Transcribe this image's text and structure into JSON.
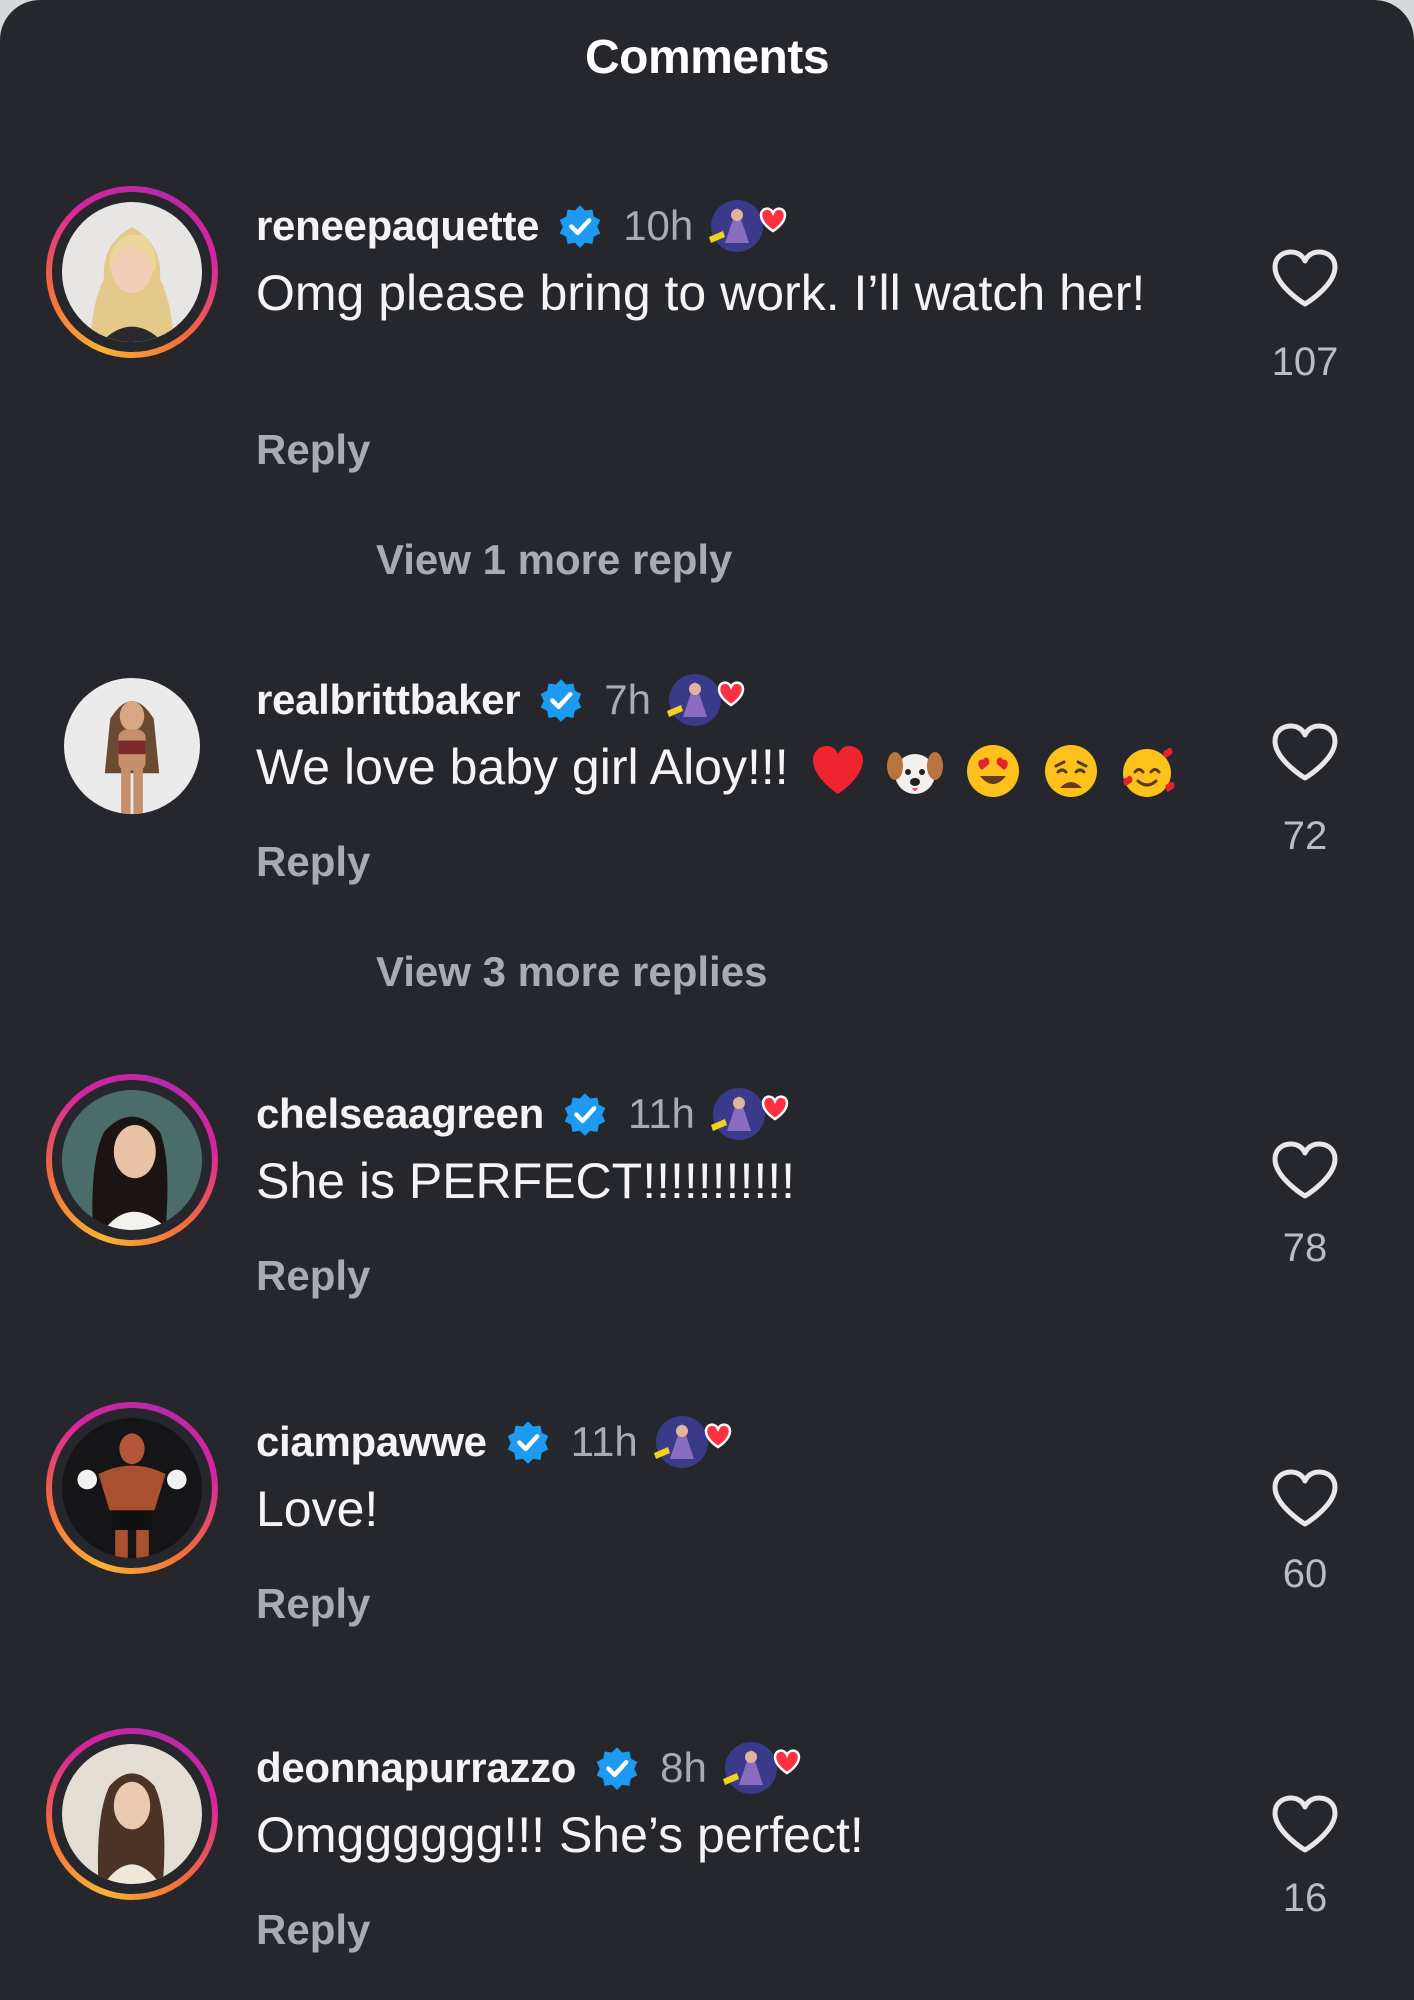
{
  "header": {
    "title": "Comments"
  },
  "colors": {
    "background": "#25272c",
    "primary_text": "#f4f4f5",
    "secondary_text": "#a8abb1",
    "verified_blue": "#1d9bf0",
    "heart_red": "#ff3040",
    "story_ring": [
      "#f9b233",
      "#f26a3d",
      "#d6249f"
    ]
  },
  "comments": [
    {
      "username": "reneepaquette",
      "verified": true,
      "time": "10h",
      "text": "Omg please bring to work. I’ll watch her!",
      "reply_label": "Reply",
      "likes": "107",
      "has_story_ring": true,
      "view_more": "View 1 more reply"
    },
    {
      "username": "realbrittbaker",
      "verified": true,
      "time": "7h",
      "text": "We love baby girl Aloy!!!",
      "emojis": [
        "red-heart",
        "dog-face",
        "heart-eyes",
        "weary-face",
        "smiling-face-with-hearts"
      ],
      "reply_label": "Reply",
      "likes": "72",
      "has_story_ring": false,
      "view_more": "View 3 more replies"
    },
    {
      "username": "chelseaagreen",
      "verified": true,
      "time": "11h",
      "text": "She is PERFECT!!!!!!!!!!!",
      "reply_label": "Reply",
      "likes": "78",
      "has_story_ring": true
    },
    {
      "username": "ciampawwe",
      "verified": true,
      "time": "11h",
      "text": "Love!",
      "reply_label": "Reply",
      "likes": "60",
      "has_story_ring": true
    },
    {
      "username": "deonnapurrazzo",
      "verified": true,
      "time": "8h",
      "text": "Omgggggg!!! She’s perfect!",
      "reply_label": "Reply",
      "likes": "16",
      "has_story_ring": true
    }
  ]
}
